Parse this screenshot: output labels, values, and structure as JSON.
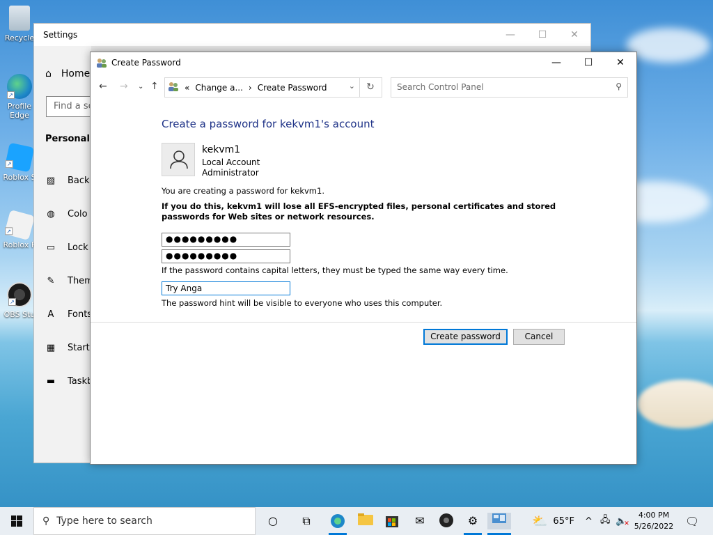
{
  "desktop": {
    "icons": [
      {
        "label": "Recycle",
        "name": "recycle-bin"
      },
      {
        "label": "Profile\nEdge",
        "name": "profile-edge"
      },
      {
        "label": "Roblox S",
        "name": "roblox-studio"
      },
      {
        "label": "Roblox P",
        "name": "roblox-player"
      },
      {
        "label": "OBS Stu",
        "name": "obs-studio"
      }
    ]
  },
  "settings": {
    "title": "Settings",
    "home": "Home",
    "find_placeholder": "Find a se",
    "section": "Personaliza",
    "items": [
      {
        "label": "Backg",
        "icon": "image-icon"
      },
      {
        "label": "Colo",
        "icon": "palette-icon"
      },
      {
        "label": "Lock s",
        "icon": "lock-screen-icon"
      },
      {
        "label": "Them",
        "icon": "themes-icon"
      },
      {
        "label": "Fonts",
        "icon": "fonts-icon"
      },
      {
        "label": "Start",
        "icon": "start-icon"
      },
      {
        "label": "Taskb",
        "icon": "taskbar-icon"
      }
    ]
  },
  "dialog": {
    "title": "Create Password",
    "address": {
      "crumb1": "Change a...",
      "crumb2": "Create Password"
    },
    "search_placeholder": "Search Control Panel",
    "heading": "Create a password for kekvm1's account",
    "user": {
      "name": "kekvm1",
      "type1": "Local Account",
      "type2": "Administrator"
    },
    "info": "You are creating a password for kekvm1.",
    "warning": "If you do this, kekvm1 will lose all EFS-encrypted files, personal certificates and stored passwords for Web sites or network resources.",
    "password_value": "●●●●●●●●●",
    "confirm_value": "●●●●●●●●●",
    "caps_note": "If the password contains capital letters, they must be typed the same way every time.",
    "hint_value": "Try Anga",
    "hint_note": "The password hint will be visible to everyone who uses this computer.",
    "create_button": "Create password",
    "cancel_button": "Cancel"
  },
  "taskbar": {
    "search_placeholder": "Type here to search",
    "weather_temp": "65°F",
    "time": "4:00 PM",
    "date": "5/26/2022"
  },
  "colors": {
    "accent": "#0078d7",
    "heading": "#1e3287"
  }
}
